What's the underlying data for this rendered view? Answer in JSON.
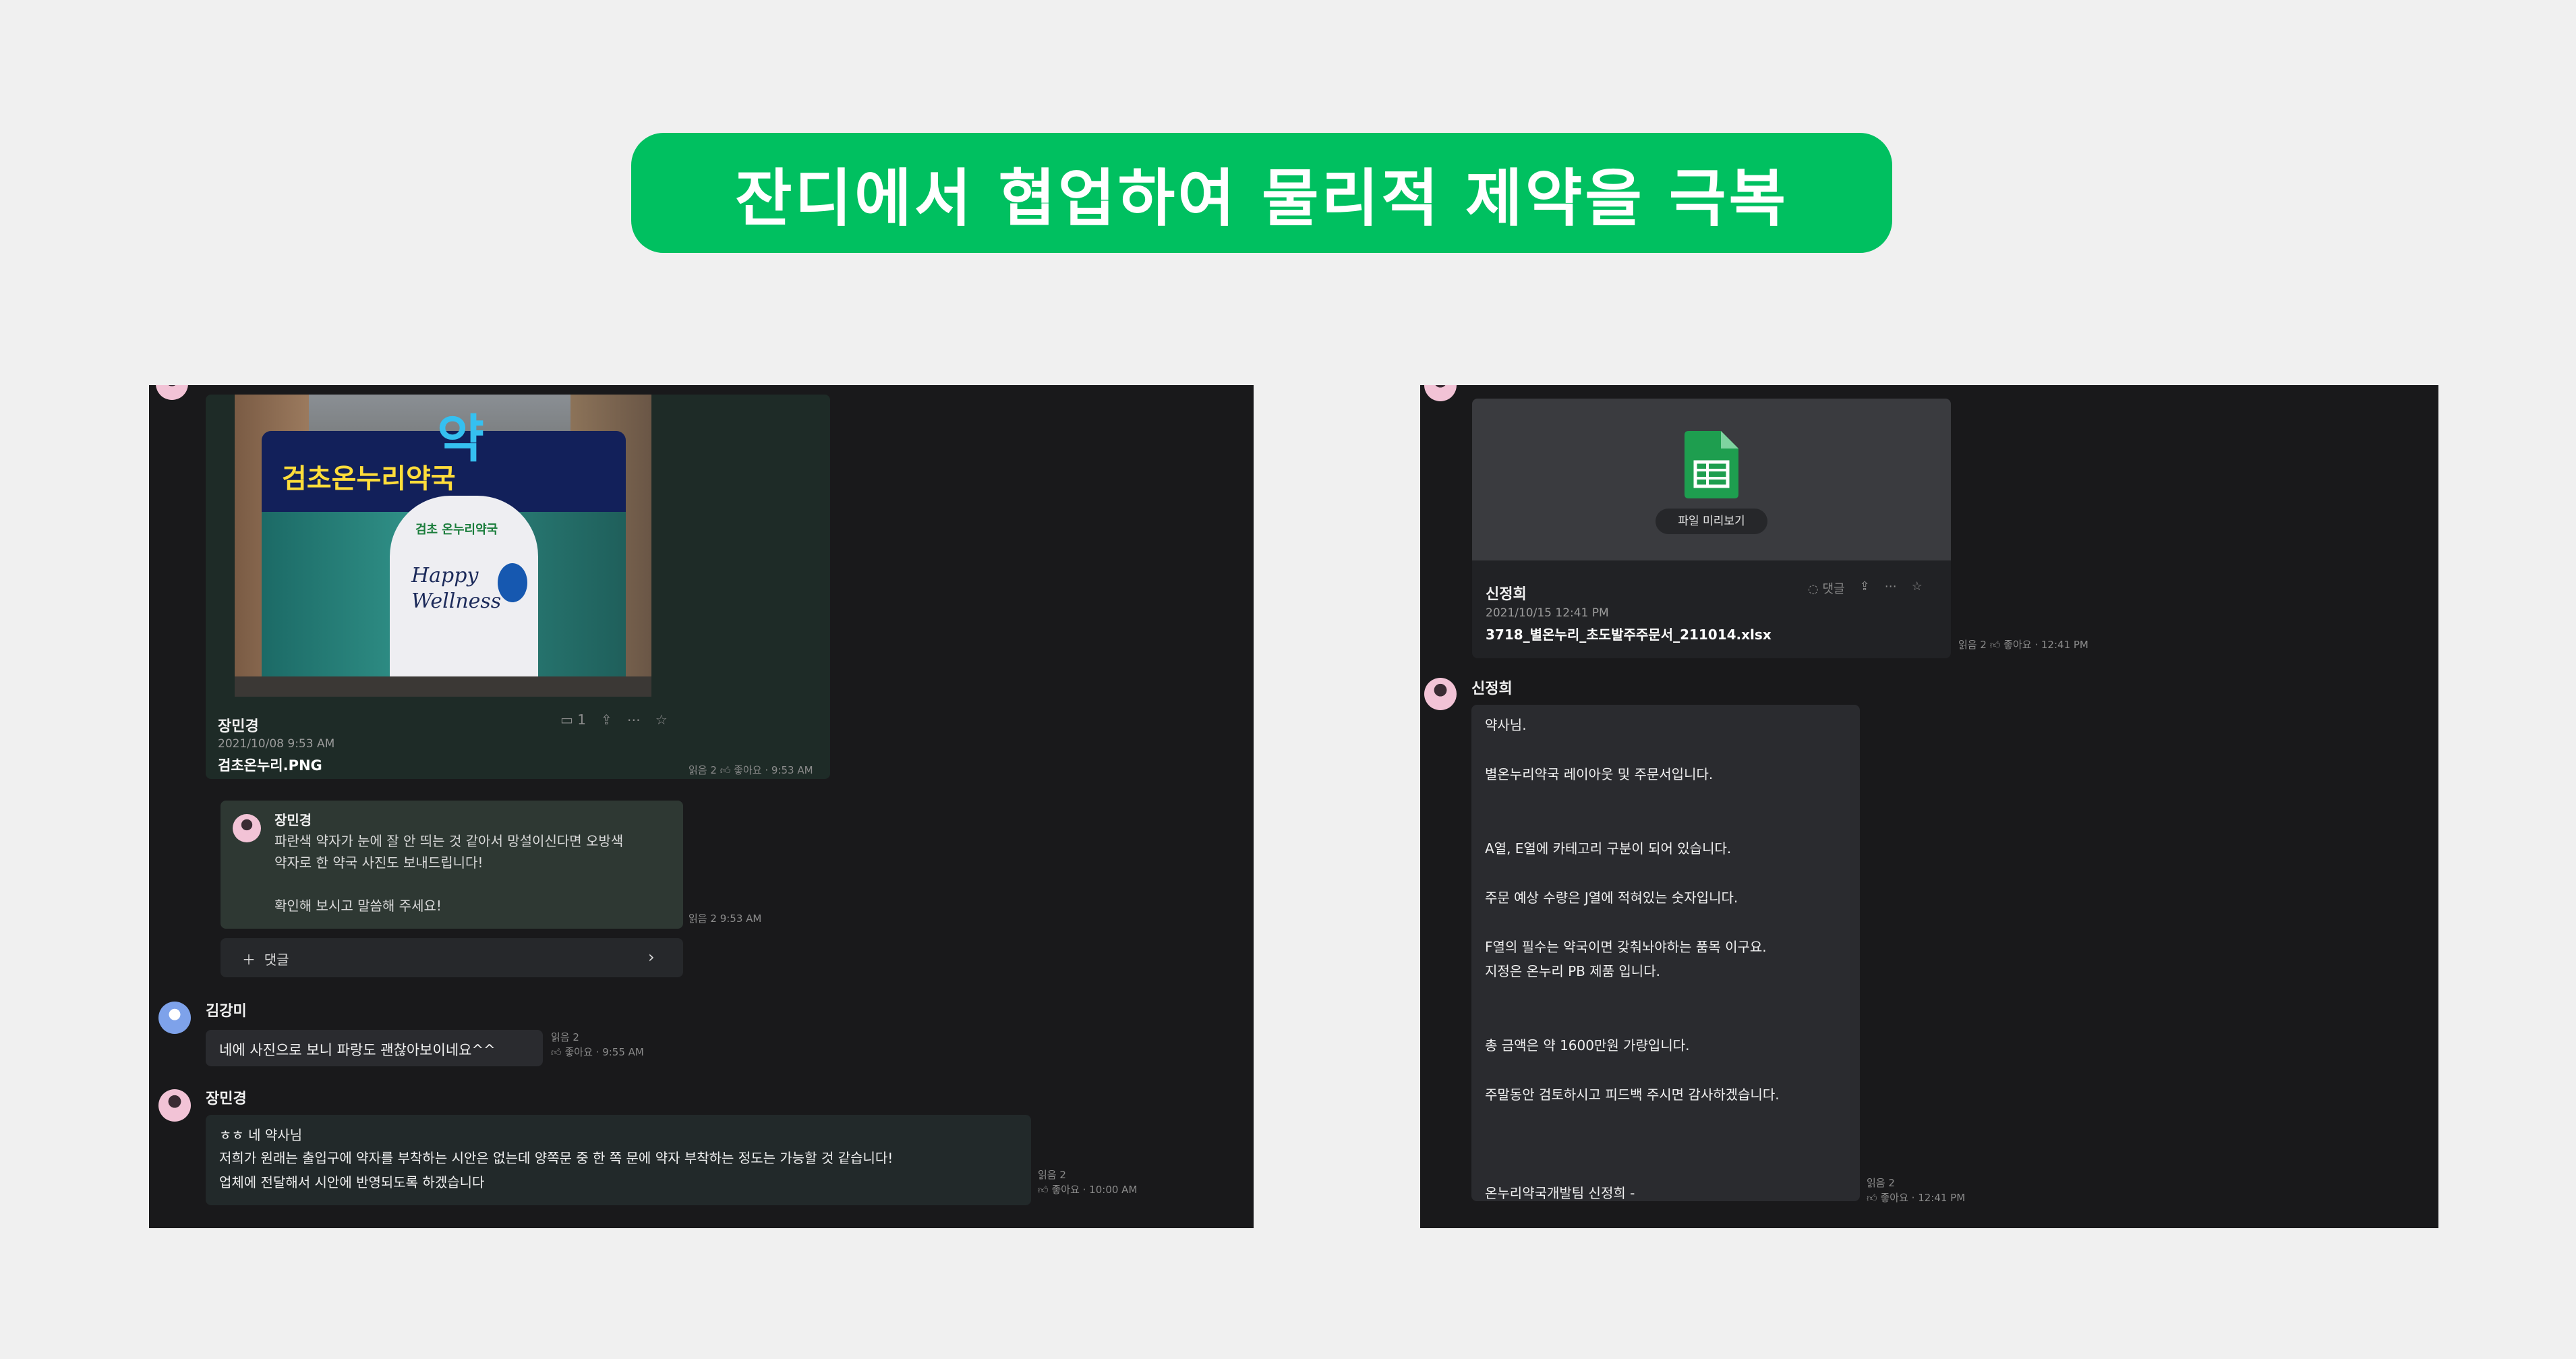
{
  "banner": {
    "title": "잔디에서 협업하여 물리적 제약을 극복"
  },
  "left_chat": {
    "image_post": {
      "author": "장민경",
      "date": "2021/10/08 9:53 AM",
      "filename": "검초온누리.PNG",
      "comment_count": "1",
      "read_status": "읽음 2",
      "like_label": "좋아요",
      "time": "9:53 AM",
      "photo_sign": "검초온누리약국",
      "photo_big": "약",
      "photo_brand": "검초 온누리약국",
      "photo_happy": "Happy",
      "photo_wellness": "Wellness"
    },
    "reply": {
      "author": "장민경",
      "lines": [
        "파란색 약자가 눈에 잘 안 띄는 것 같아서 망설이신다면 오방색",
        "약자로 한 약국 사진도 보내드립니다!",
        "",
        "확인해 보시고 말씀해 주세요!"
      ],
      "read_status": "읽음 2",
      "time": "9:53 AM"
    },
    "add_reply_label": "댓글",
    "msg_kim": {
      "author": "김강미",
      "text": "네에  사진으로 보니  파랑도 괜찮아보이네요^^",
      "read_status": "읽음 2",
      "like_label": "좋아요",
      "time": "9:55 AM"
    },
    "msg_jang": {
      "author": "장민경",
      "lines": [
        "ㅎㅎ 네 약사님",
        "저희가 원래는 출입구에 약자를 부착하는 시안은 없는데 양쪽문 중 한 쪽 문에 약자 부착하는 정도는 가능할 것 같습니다!",
        "업체에 전달해서 시안에 반영되도록 하겠습니다"
      ],
      "read_status": "읽음 2",
      "like_label": "좋아요",
      "time": "10:00 AM"
    }
  },
  "right_chat": {
    "file_post": {
      "preview_button": "파일 미리보기",
      "author": "신정희",
      "date": "2021/10/15 12:41 PM",
      "filename": "3718_별온누리_초도발주주문서_211014.xlsx",
      "comment_label": "댓글",
      "read_status": "읽음 2",
      "like_label": "좋아요",
      "time": "12:41 PM"
    },
    "message": {
      "author": "신정희",
      "lines": [
        "약사님.",
        "",
        "별온누리약국 레이아웃 및 주문서입니다.",
        "",
        "",
        "A열, E열에 카테고리 구분이 되어 있습니다.",
        "",
        "주문 예상 수량은 J열에 적혀있는 숫자입니다.",
        "",
        "F열의 필수는 약국이면 갖춰놔야하는 품목 이구요.",
        "지정은 온누리 PB 제품 입니다.",
        "",
        "",
        "총 금액은 약 1600만원 가량입니다.",
        "",
        "주말동안 검토하시고 피드백 주시면 감사하겠습니다.",
        "",
        "",
        "",
        "온누리약국개발팀 신정희 -"
      ],
      "read_status": "읽음 2",
      "like_label": "좋아요",
      "time": "12:41 PM"
    }
  },
  "colors": {
    "banner": "#00c060",
    "panel": "#19191b",
    "bubble": "#22292a",
    "accent_sheet": "#1e9e4f"
  }
}
